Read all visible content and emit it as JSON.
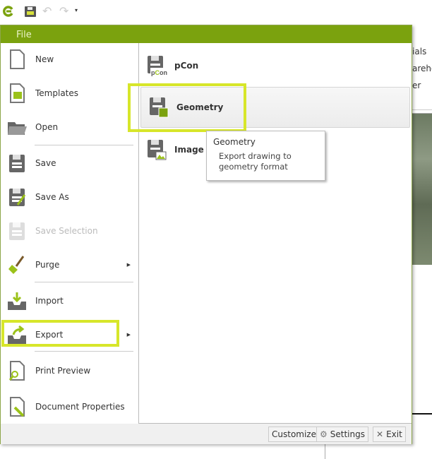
{
  "quick_access": {
    "icons": [
      "app-logo",
      "save-icon",
      "undo-icon",
      "redo-icon",
      "customize-dropdown-icon"
    ]
  },
  "background": {
    "texts": [
      "ials",
      "areho",
      "er"
    ]
  },
  "menu": {
    "file_label": "File",
    "left_items": [
      {
        "label": "New",
        "icon": "new-document-icon"
      },
      {
        "label": "Templates",
        "icon": "templates-icon"
      },
      {
        "label": "Open",
        "icon": "folder-open-icon"
      },
      {
        "label": "Save",
        "icon": "save-icon"
      },
      {
        "label": "Save As",
        "icon": "save-as-icon"
      },
      {
        "label": "Save Selection",
        "icon": "save-selection-icon",
        "disabled": true
      },
      {
        "label": "Purge",
        "icon": "broom-icon",
        "submenu": true
      },
      {
        "label": "Import",
        "icon": "import-icon"
      },
      {
        "label": "Export",
        "icon": "export-icon",
        "submenu": true,
        "selected": true
      },
      {
        "label": "Print Preview",
        "icon": "print-preview-icon"
      },
      {
        "label": "Document Properties",
        "icon": "document-properties-icon"
      }
    ],
    "export_items": [
      {
        "label": "pCon",
        "icon": "pcon-export-icon",
        "icon_text": "pCon"
      },
      {
        "label": "Geometry",
        "icon": "geometry-export-icon",
        "hovered": true
      },
      {
        "label": "Image",
        "icon": "image-export-icon"
      }
    ],
    "tooltip": {
      "title": "Geometry",
      "body_line1": "Export drawing to",
      "body_line2": "geometry format"
    },
    "bottom": {
      "customize": "Customize",
      "settings": "Settings",
      "exit": "Exit"
    }
  },
  "colors": {
    "accent": "#7ba20e",
    "highlight": "#d7e62a"
  }
}
